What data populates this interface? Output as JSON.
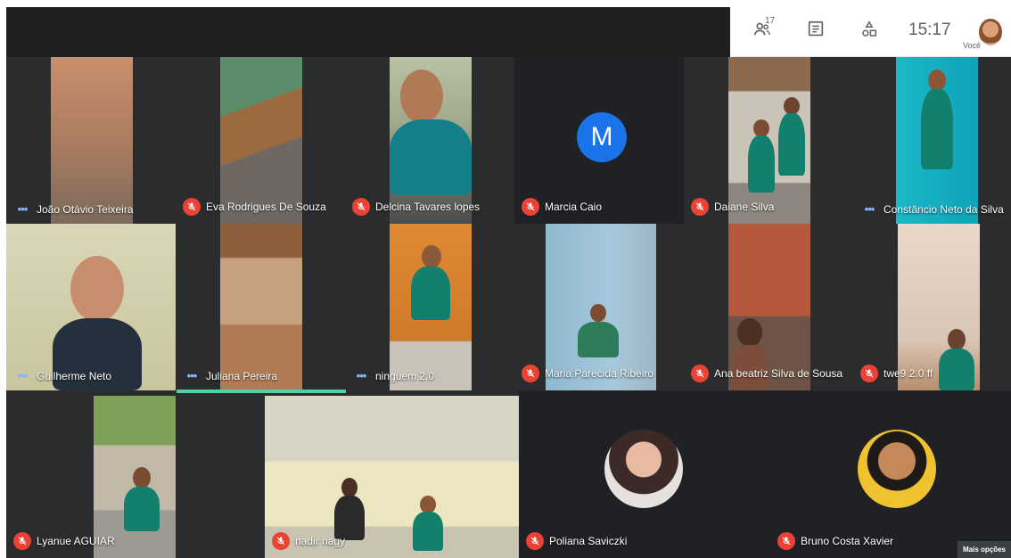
{
  "header": {
    "participant_count": "17",
    "time": "15:17",
    "you_label": "Você"
  },
  "tiles": [
    {
      "name": "João Otávio Teixeira",
      "status": "more"
    },
    {
      "name": "Eva Rodrigues De Souza",
      "status": "muted"
    },
    {
      "name": "Delcina Tavares lopes",
      "status": "muted"
    },
    {
      "name": "Marcia Caio",
      "status": "muted",
      "initial": "M"
    },
    {
      "name": "Daiane Silva",
      "status": "muted"
    },
    {
      "name": "Constâncio Neto da Silva",
      "status": "more"
    },
    {
      "name": "Guilherme Neto",
      "status": "more"
    },
    {
      "name": "Juliana Pereira",
      "status": "more"
    },
    {
      "name": "ninguem 2.0",
      "status": "more"
    },
    {
      "name": "Maria Parecida Ribeiro",
      "status": "muted"
    },
    {
      "name": "Ana beatriz Silva de Sousa",
      "status": "muted"
    },
    {
      "name": "twe9 2.0 ff",
      "status": "muted"
    },
    {
      "name": "Lyanue AGUIAR",
      "status": "muted"
    },
    {
      "name": "nadir nagy",
      "status": "muted"
    },
    {
      "name": "Poliana Saviczki",
      "status": "muted"
    },
    {
      "name": "Bruno Costa Xavier",
      "status": "muted"
    }
  ],
  "more_options_label": "Mais opções",
  "icons": {
    "people": "people-icon",
    "chat": "chat-icon",
    "activities": "activities-icon",
    "mic_off": "mic-off-icon",
    "more": "more-dots-icon"
  },
  "colors": {
    "stage_bg": "#202124",
    "mic_off": "#ea4335",
    "speaking": "#4fd1a1",
    "avatar_blue": "#1a73e8"
  }
}
